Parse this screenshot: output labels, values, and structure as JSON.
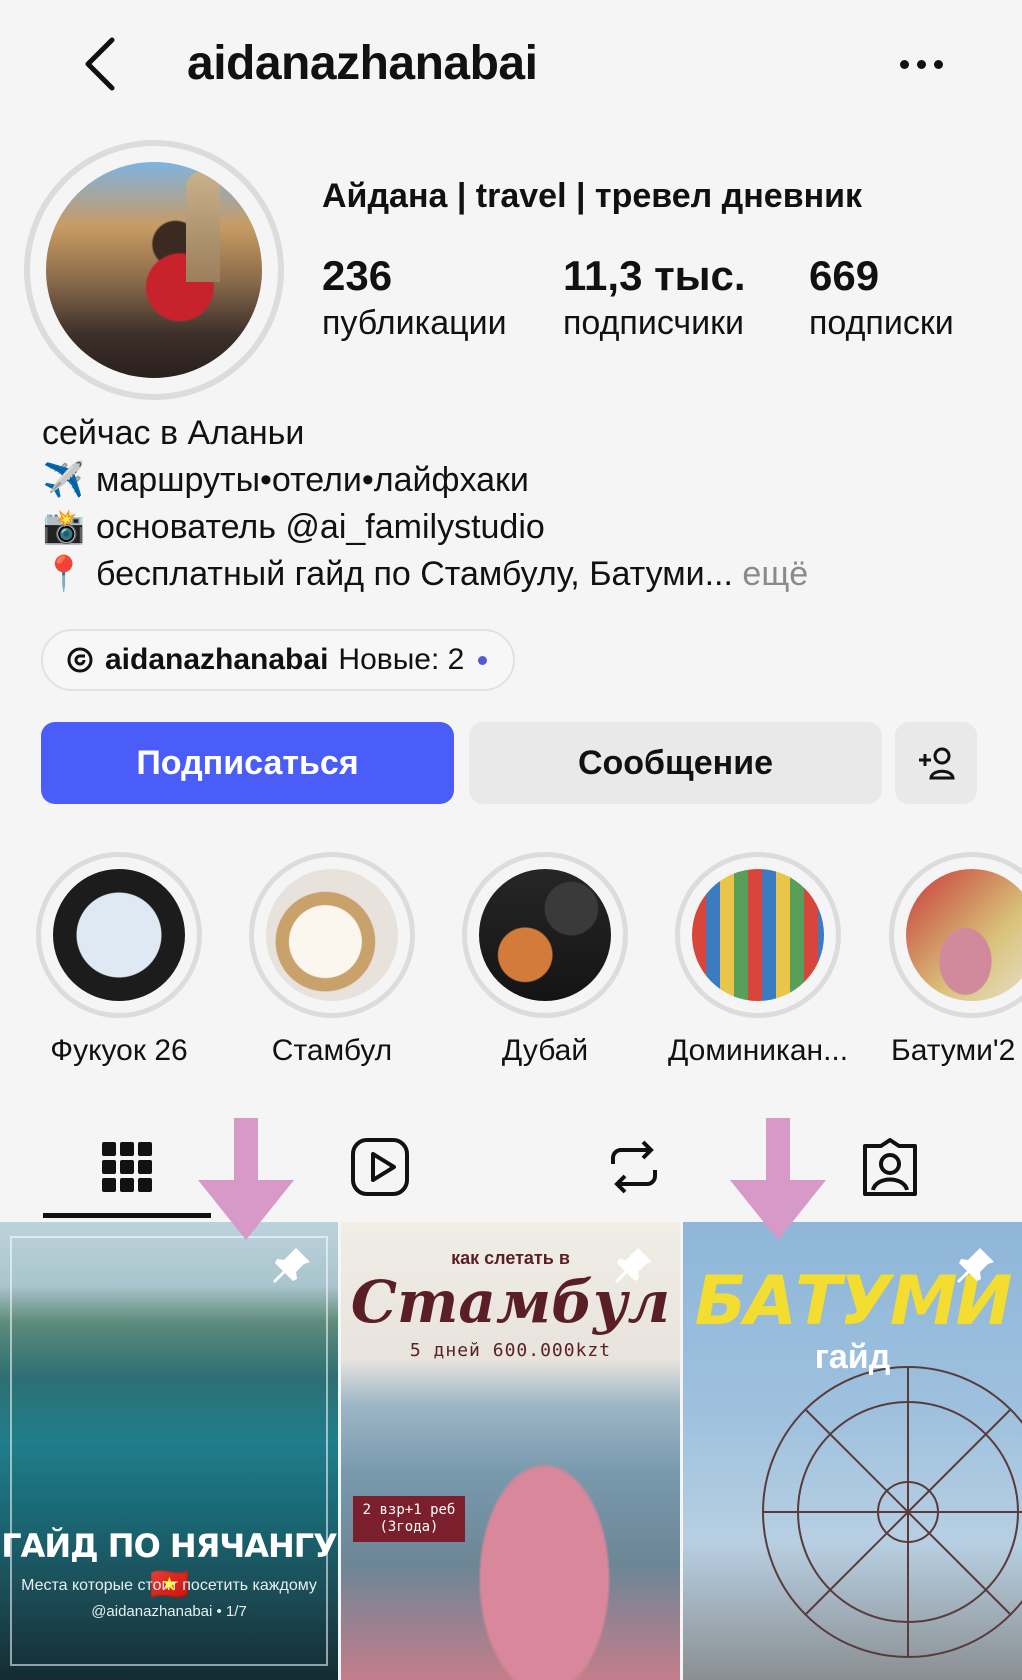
{
  "header": {
    "username": "aidanazhanabai"
  },
  "profile": {
    "display_name": "Айдана | travel | тревел дневник",
    "stats": [
      {
        "value": "236",
        "label": "публикации"
      },
      {
        "value": "11,3 тыс.",
        "label": "подписчики"
      },
      {
        "value": "669",
        "label": "подписки"
      }
    ]
  },
  "bio": {
    "line1": "сейчас в Аланьи",
    "line2_emoji": "✈️",
    "line2": "маршруты•отели•лайфхаки",
    "line3_emoji": "📸",
    "line3": "основатель @ai_familystudio",
    "line4_emoji": "📍",
    "line4": "бесплатный гайд по Стамбулу, Батуми...",
    "more": "ещё"
  },
  "threads": {
    "handle": "aidanazhanabai",
    "new_label": "Новые: 2"
  },
  "actions": {
    "follow": "Подписаться",
    "message": "Сообщение"
  },
  "highlights": [
    {
      "label": "Фукуок 26"
    },
    {
      "label": "Стамбул"
    },
    {
      "label": "Дубай"
    },
    {
      "label": "Доминикан..."
    },
    {
      "label": "Батуми'2"
    }
  ],
  "tabs": [
    "grid-icon",
    "reels-icon",
    "reposts-icon",
    "tagged-icon"
  ],
  "grid": {
    "post1": {
      "title": "ГАЙД ПО НЯЧАНГУ",
      "flag": "🇻🇳",
      "subtitle": "Места которые стоит посетить каждому",
      "handle": "@aidanazhanabai • 1/7"
    },
    "post2": {
      "top": "как слетать в",
      "title": "Стамбул",
      "subtitle": "5 дней 600.000kzt",
      "badge": "2 взр+1 реб (3года)"
    },
    "post3": {
      "title": "БАТУМИ",
      "subtitle": "гайд"
    }
  },
  "colors": {
    "accent": "#4a5df9",
    "arrow": "#d79ac8"
  }
}
